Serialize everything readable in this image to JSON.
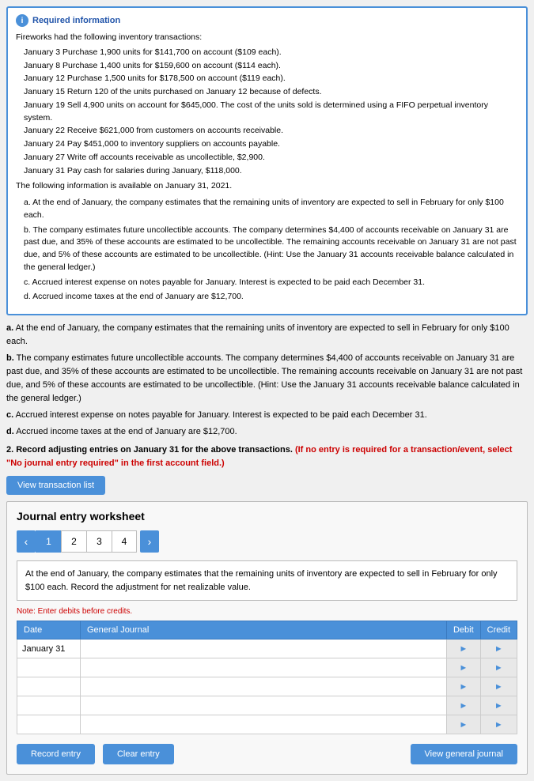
{
  "required_info": {
    "title": "Required information",
    "intro": "Fireworks had the following inventory transactions:",
    "transactions": [
      "January  3  Purchase 1,900 units for $141,700 on account ($109 each).",
      "January  8  Purchase 1,400 units for $159,600 on account ($114 each).",
      "January 12  Purchase 1,500 units for $178,500 on account ($119 each).",
      "January 15  Return 120 of the units purchased on January 12 because of defects.",
      "January 19  Sell 4,900 units on account for $645,000. The cost of the units sold is determined using a FIFO perpetual inventory system.",
      "January 22  Receive $621,000 from customers on accounts receivable.",
      "January 24  Pay $451,000 to inventory suppliers on accounts payable.",
      "January 27  Write off accounts receivable as uncollectible, $2,900.",
      "January 31  Pay cash for salaries during January, $118,000."
    ],
    "following_info": "The following information is available on January 31, 2021.",
    "items": [
      "a. At the end of January, the company estimates that the remaining units of inventory are expected to sell in February for only $100 each.",
      "b. The company estimates future uncollectible accounts. The company determines $4,400 of accounts receivable on January 31 are past due, and 35% of these accounts are estimated to be uncollectible. The remaining accounts receivable on January 31 are not past due, and 5% of these accounts are estimated to be uncollectible. (Hint: Use the January 31 accounts receivable balance calculated in the general ledger.)",
      "c. Accrued interest expense on notes payable for January. Interest is expected to be paid each December 31.",
      "d. Accrued income taxes at the end of January are $12,700."
    ]
  },
  "main_content": {
    "item_a": "a. At the end of January, the company estimates that the remaining units of inventory are expected to sell in February for only $100 each.",
    "item_b_1": "b. The company estimates future uncollectible accounts. The company determines $4,400 of accounts receivable on January 31 are",
    "item_b_2": "past due, and 35% of these accounts are estimated to be uncollectible. The remaining accounts receivable on January 31 are not past",
    "item_b_3": "due, and 5% of these accounts are estimated to be uncollectible. (Hint: Use the January 31 accounts receivable balance calculated in",
    "item_b_4": "the general ledger.)",
    "item_c": "c. Accrued interest expense on notes payable for January. Interest is expected to be paid each December 31.",
    "item_d": "d. Accrued income taxes at the end of January are $12,700.",
    "instruction_1": "2. Record adjusting entries on January 31 for the above transactions.",
    "instruction_red": "(If no entry is required for a transaction/event, select \"No journal entry required\" in the first account field.)"
  },
  "view_transaction_btn": "View transaction list",
  "worksheet": {
    "title": "Journal entry worksheet",
    "tabs": [
      "1",
      "2",
      "3",
      "4"
    ],
    "active_tab": 1,
    "description": "At the end of January, the company estimates that the remaining units of inventory are expected to sell in February for only $100 each. Record the adjustment for net realizable value.",
    "note": "Note: Enter debits before credits.",
    "table": {
      "headers": [
        "Date",
        "General Journal",
        "Debit",
        "Credit"
      ],
      "rows": [
        {
          "date": "January 31",
          "journal": "",
          "debit": "",
          "credit": ""
        },
        {
          "date": "",
          "journal": "",
          "debit": "",
          "credit": ""
        },
        {
          "date": "",
          "journal": "",
          "debit": "",
          "credit": ""
        },
        {
          "date": "",
          "journal": "",
          "debit": "",
          "credit": ""
        },
        {
          "date": "",
          "journal": "",
          "debit": "",
          "credit": ""
        }
      ]
    },
    "buttons": {
      "record": "Record entry",
      "clear": "Clear entry",
      "view_general": "View general journal"
    }
  }
}
